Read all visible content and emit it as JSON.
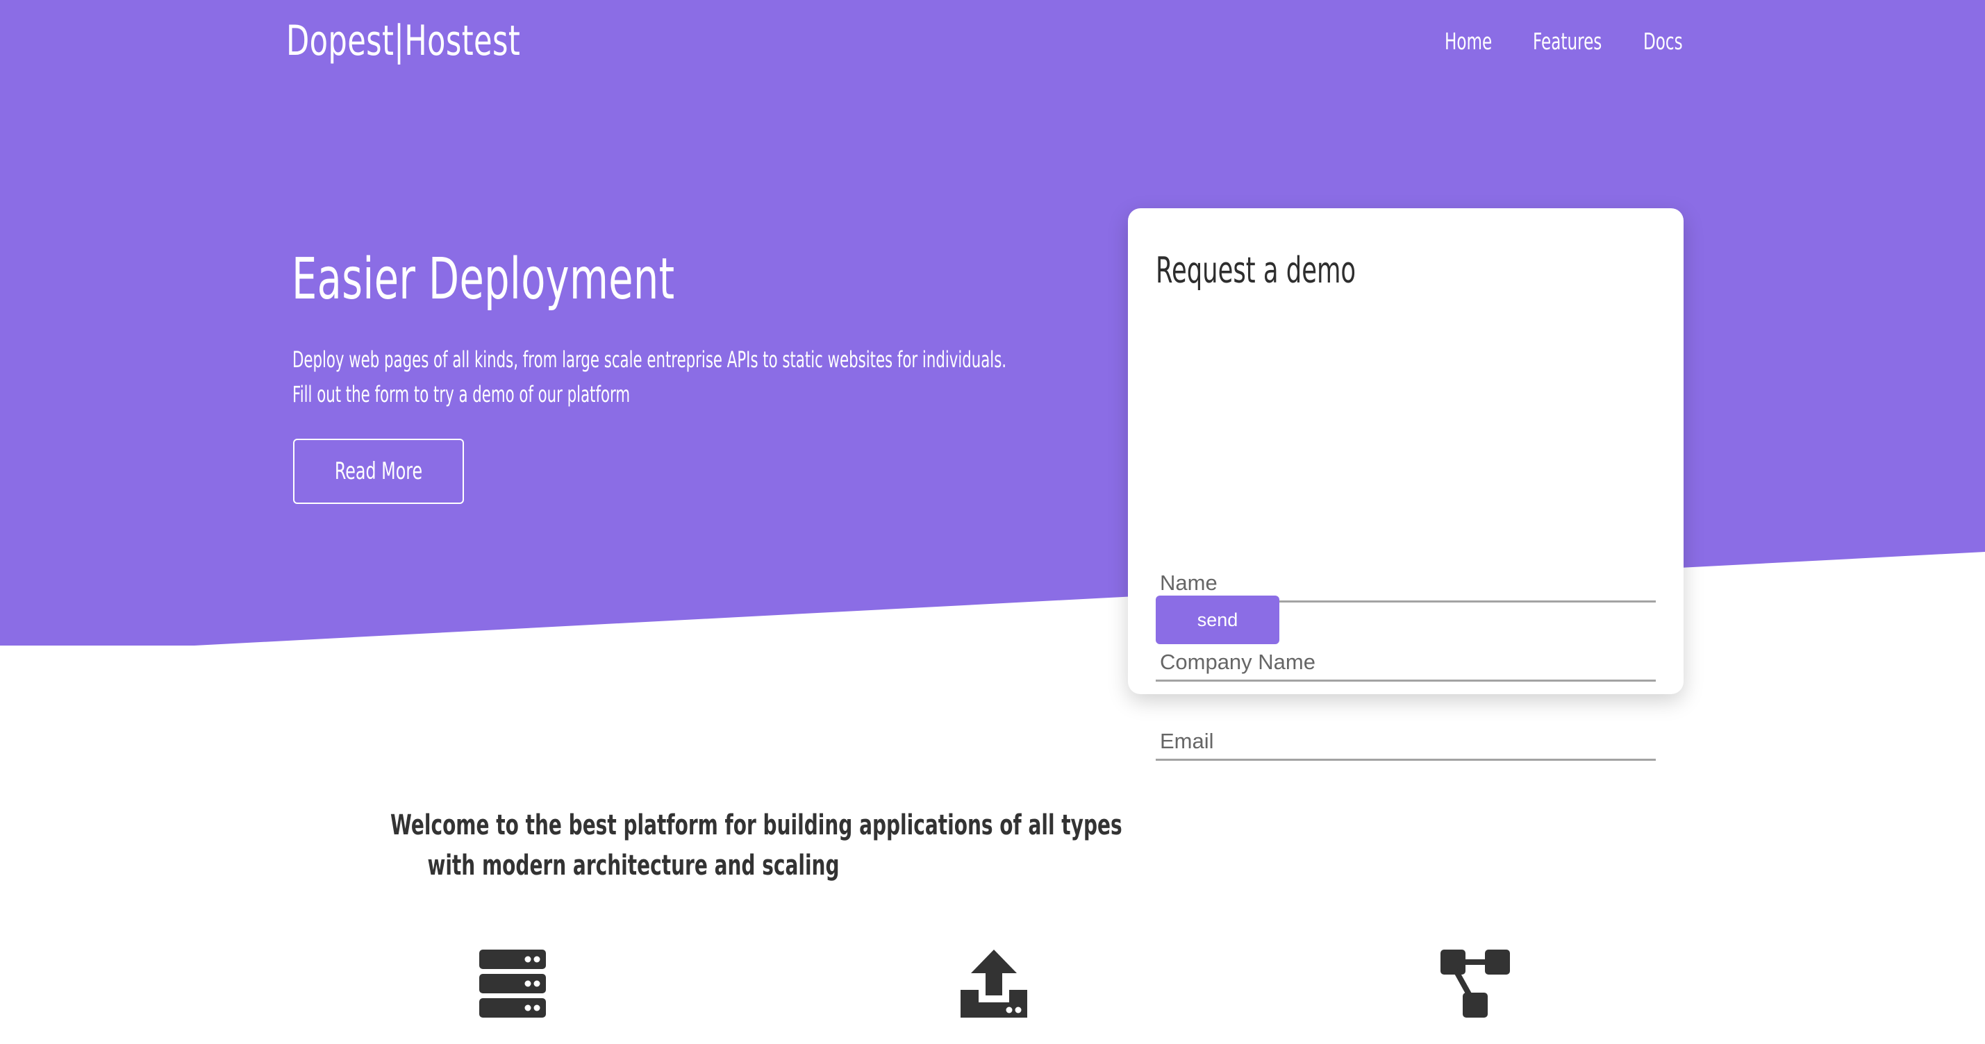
{
  "colors": {
    "brand_purple": "#8b6de5",
    "text_dark": "#333333",
    "white": "#ffffff"
  },
  "navbar": {
    "brand": "Dopest|Hostest",
    "links": [
      {
        "label": "Home"
      },
      {
        "label": "Features"
      },
      {
        "label": "Docs"
      }
    ]
  },
  "hero": {
    "title": "Easier Deployment",
    "description_lines": [
      "Deploy web pages of all kinds, from large scale entreprise APIs to static websites for individuals.",
      "Fill out the form to try a demo of our platform"
    ],
    "read_more_label": "Read More"
  },
  "demo_form": {
    "title": "Request a demo",
    "fields": [
      {
        "placeholder": "Name",
        "value": ""
      },
      {
        "placeholder": "Company Name",
        "value": ""
      },
      {
        "placeholder": "Email",
        "value": ""
      }
    ],
    "send_label": "send"
  },
  "welcome": {
    "lines": [
      "Welcome to the best platform for building applications of all types",
      "with modern architecture and scaling"
    ]
  },
  "stats": [
    {
      "icon": "server-icon",
      "value": ""
    },
    {
      "icon": "upload-icon",
      "value": ""
    },
    {
      "icon": "network-icon",
      "value": ""
    }
  ]
}
